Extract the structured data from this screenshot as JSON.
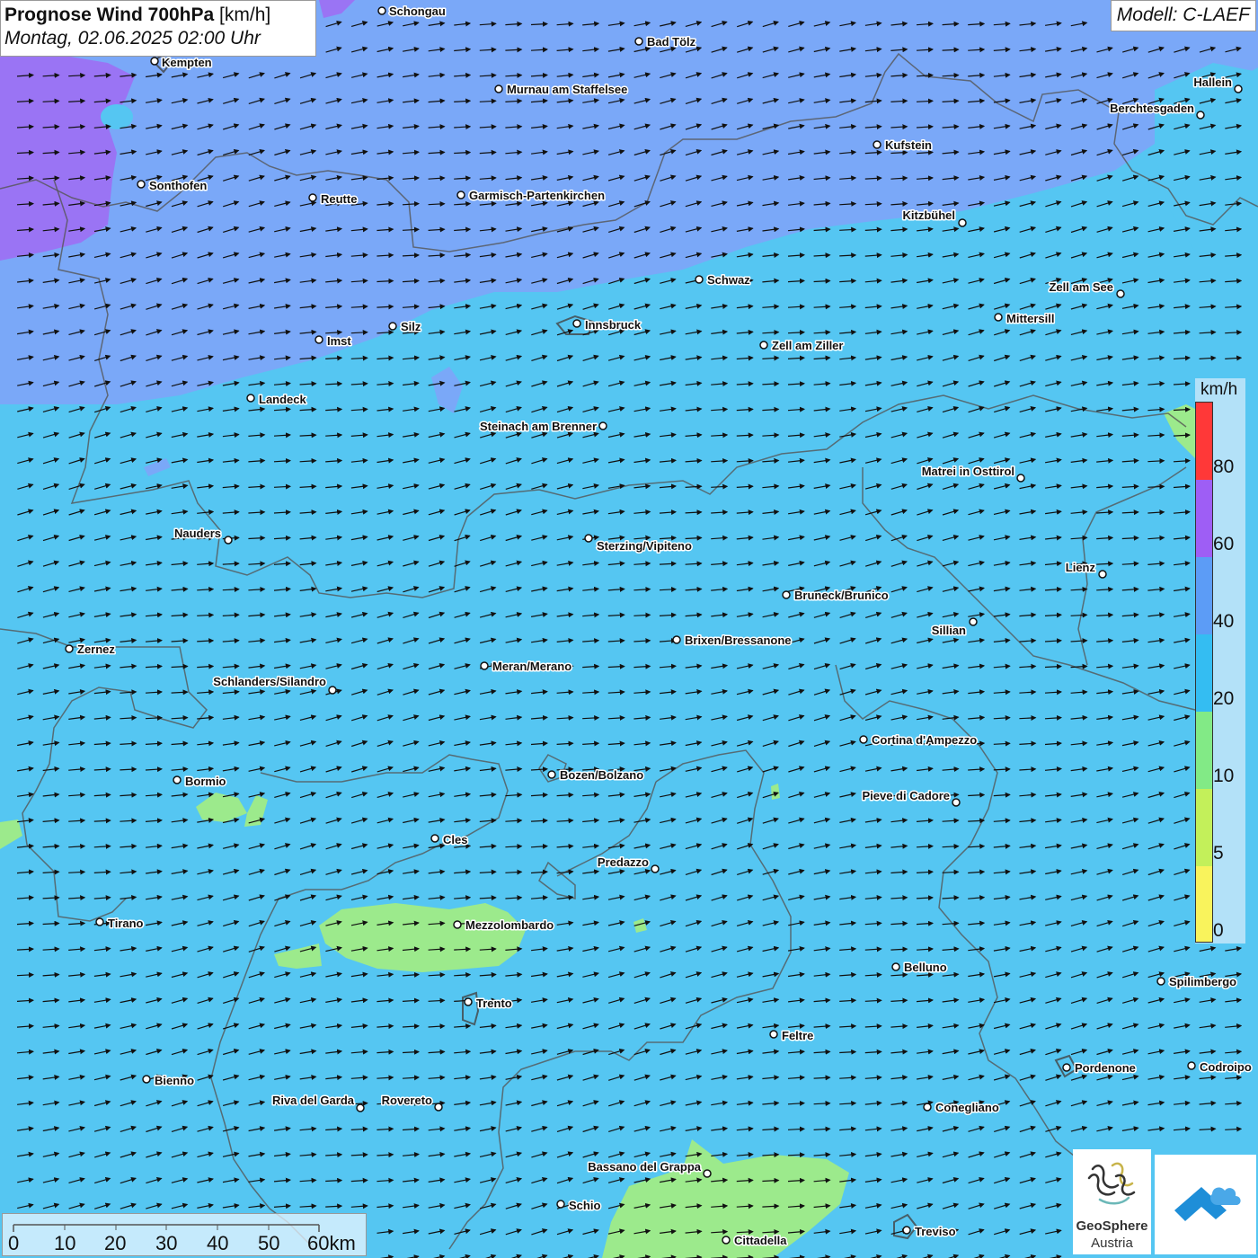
{
  "title": {
    "main": "Prognose Wind 700hPa",
    "unit": "[km/h]",
    "date": "Montag, 02.06.2025 02:00 Uhr"
  },
  "model": "Modell: C-LAEF",
  "legend": {
    "unit": "km/h",
    "labels": [
      "80",
      "60",
      "40",
      "20",
      "10",
      "5",
      "0"
    ],
    "colors": [
      "#ff3838",
      "#9e5ef5",
      "#5c9cf6",
      "#34bdf2",
      "#82ea86",
      "#c3f05a",
      "#f9f35c"
    ]
  },
  "scalebar": {
    "labels": [
      "0",
      "10",
      "20",
      "30",
      "40",
      "50",
      "60km"
    ]
  },
  "logos": {
    "geosphere_line1": "GeoSphere",
    "geosphere_line2": "Austria",
    "geosphere_icon": "geosphere-logo-icon",
    "cloud_icon": "cloud-arrow-logo-icon"
  },
  "colors": {
    "purple_zone": "#9a74f4",
    "blue_zone": "#7aa8f8",
    "cyan_zone": "#55c6f2",
    "green_zone": "#9cea8c",
    "arrow": "#111111"
  },
  "cities": [
    {
      "name": "Schongau"
    },
    {
      "name": "Bad Tölz"
    },
    {
      "name": "Kempten"
    },
    {
      "name": "Murnau am Staffelsee"
    },
    {
      "name": "Hallein"
    },
    {
      "name": "Berchtesgaden"
    },
    {
      "name": "Kufstein"
    },
    {
      "name": "Sonthofen"
    },
    {
      "name": "Reutte"
    },
    {
      "name": "Garmisch-Partenkirchen"
    },
    {
      "name": "Kitzbühel"
    },
    {
      "name": "Schwaz"
    },
    {
      "name": "Zell am See"
    },
    {
      "name": "Mittersill"
    },
    {
      "name": "Innsbruck"
    },
    {
      "name": "Silz"
    },
    {
      "name": "Imst"
    },
    {
      "name": "Zell am Ziller"
    },
    {
      "name": "Landeck"
    },
    {
      "name": "Steinach am Brenner"
    },
    {
      "name": "Matrei in Osttirol"
    },
    {
      "name": "Nauders"
    },
    {
      "name": "Sterzing/Vipiteno"
    },
    {
      "name": "Lienz"
    },
    {
      "name": "Bruneck/Brunico"
    },
    {
      "name": "Sillian"
    },
    {
      "name": "Brixen/Bressanone"
    },
    {
      "name": "Zernez"
    },
    {
      "name": "Meran/Merano"
    },
    {
      "name": "Schlanders/Silandro"
    },
    {
      "name": "Cortina d'Ampezzo"
    },
    {
      "name": "Bozen/Bolzano"
    },
    {
      "name": "Bormio"
    },
    {
      "name": "Pieve di Cadore"
    },
    {
      "name": "Cles"
    },
    {
      "name": "Predazzo"
    },
    {
      "name": "Tirano"
    },
    {
      "name": "Mezzolombardo"
    },
    {
      "name": "Belluno"
    },
    {
      "name": "Spilimbergo"
    },
    {
      "name": "Trento"
    },
    {
      "name": "Feltre"
    },
    {
      "name": "Pordenone"
    },
    {
      "name": "Codroipo"
    },
    {
      "name": "Bienno"
    },
    {
      "name": "Riva del Garda"
    },
    {
      "name": "Rovereto"
    },
    {
      "name": "Conegliano"
    },
    {
      "name": "Bassano del Grappa"
    },
    {
      "name": "Schio"
    },
    {
      "name": "Treviso"
    },
    {
      "name": "Cittadella"
    }
  ]
}
